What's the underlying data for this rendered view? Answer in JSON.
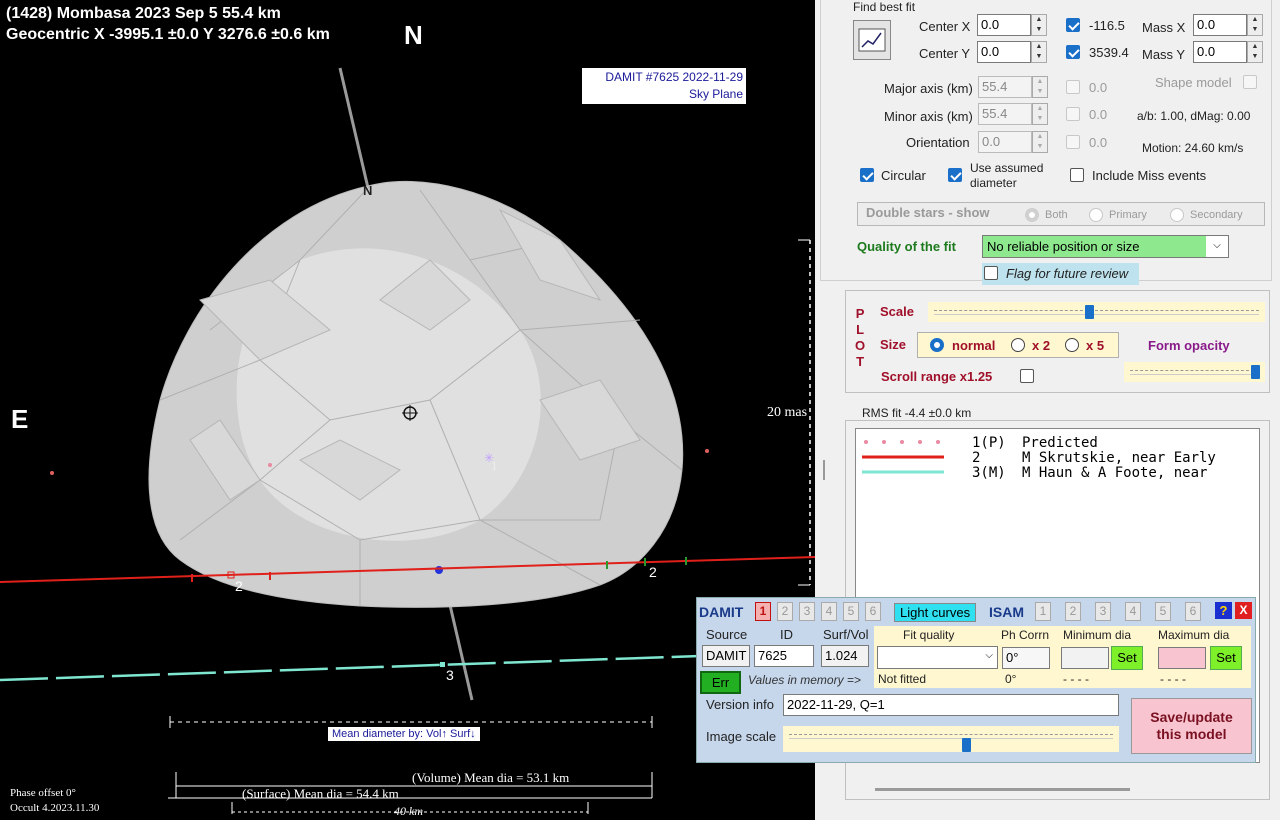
{
  "plot": {
    "header_line1": "(1428) Mombasa  2023 Sep 5   55.4 km",
    "header_line2": "Geocentric  X  -3995.1 ±0.0  Y 3276.6 ±0.6 km",
    "north": "N",
    "east": "E",
    "pole_label": "N",
    "damit_line1": "DAMIT #7625 2022-11-29",
    "damit_line2": "Sky Plane",
    "scale_mas": "20 mas",
    "chord_label_2a": "2",
    "chord_label_2b": "2",
    "chord_label_3": "3",
    "center_label_1": "1",
    "mean_dia_by": "Mean diameter by: Vol↑ Surf↓",
    "volume_dia": "(Volume) Mean dia = 53.1 km",
    "surface_dia": "(Surface) Mean dia = 54.4 km",
    "scale_km": "40 km",
    "phase_offset": "Phase offset 0°",
    "version": "Occult 4.2023.11.30"
  },
  "fit": {
    "title": "Find best fit",
    "center_x_label": "Center X",
    "center_x": "0.0",
    "center_y_label": "Center Y",
    "center_y": "0.0",
    "fixed_x": "-116.5",
    "fixed_y": "3539.4",
    "mass_x_label": "Mass X",
    "mass_x": "0.0",
    "mass_y_label": "Mass Y",
    "mass_y": "0.0",
    "major_label": "Major axis (km)",
    "major": "55.4",
    "minor_label": "Minor axis (km)",
    "minor": "55.4",
    "orient_label": "Orientation",
    "orient": "0.0",
    "major_fix": "0.0",
    "minor_fix": "0.0",
    "orient_fix": "0.0",
    "shape_model": "Shape model",
    "ab_dmag": "a/b: 1.00, dMag: 0.00",
    "motion": "Motion: 24.60 km/s",
    "circular": "Circular",
    "assumed_1": "Use assumed",
    "assumed_2": "diameter",
    "include_miss": "Include Miss events",
    "double_stars": "Double stars - show",
    "both": "Both",
    "primary": "Primary",
    "secondary": "Secondary",
    "quality_label": "Quality of the fit",
    "quality_value": "No reliable position or size",
    "flag_review": "Flag for future review"
  },
  "plotctl": {
    "p": "P",
    "l": "L",
    "o": "O",
    "t": "T",
    "scale": "Scale",
    "size": "Size",
    "normal": "normal",
    "x2": "x 2",
    "x5": "x 5",
    "form_opacity": "Form opacity",
    "scroll_range": "Scroll range x1.25",
    "scale_level": 0.48,
    "opacity_level": 0.97
  },
  "rms": "RMS fit -4.4 ±0.0 km",
  "legend": [
    {
      "id": "1(P)",
      "text": "Predicted"
    },
    {
      "id": "2",
      "text": "M Skrutskie, near Early"
    },
    {
      "id": "3(M)",
      "text": "M Haun & A Foote, near"
    }
  ],
  "damit": {
    "title": "DAMIT",
    "nums": [
      "1",
      "2",
      "3",
      "4",
      "5",
      "6"
    ],
    "light_curves": "Light curves",
    "isam": "ISAM",
    "isam_nums": [
      "1",
      "2",
      "3",
      "4",
      "5",
      "6"
    ],
    "help": "?",
    "close": "X",
    "source_h": "Source",
    "id_h": "ID",
    "surf_h": "Surf/Vol",
    "source": "DAMIT",
    "id": "7625",
    "surf": "1.024",
    "fit_quality_h": "Fit quality",
    "ph_corrn_h": "Ph Corrn",
    "min_dia_h": "Minimum dia",
    "max_dia_h": "Maximum dia",
    "ph_corrn": "0°",
    "set": "Set",
    "err": "Err",
    "values_mem": "Values in memory =>",
    "not_fitted": "Not fitted",
    "ph_mem": "0°",
    "dash1": "- - - -",
    "dash2": "- - - -",
    "version_label": "Version info",
    "version": "2022-11-29, Q=1",
    "image_scale": "Image scale",
    "save_1": "Save/update",
    "save_2": "this model",
    "image_scale_level": 0.55
  },
  "colors": {
    "chord_red": "#e0201a",
    "chord_cyan": "#7fe6d0",
    "accent": "#1a6fc8",
    "quality_bg": "#8ee88e"
  }
}
